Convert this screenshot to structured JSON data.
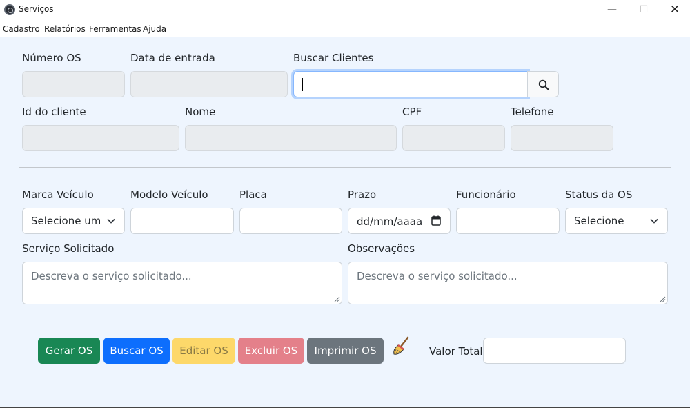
{
  "window": {
    "title": "Serviços"
  },
  "menu": [
    "Cadastro",
    "Relatórios",
    "Ferramentas",
    "Ajuda"
  ],
  "labels": {
    "numero_os": "Número OS",
    "data_entrada": "Data de entrada",
    "buscar_clientes": "Buscar Clientes",
    "id_cliente": "Id do cliente",
    "nome": "Nome",
    "cpf": "CPF",
    "telefone": "Telefone",
    "marca_veiculo": "Marca Veículo",
    "modelo_veiculo": "Modelo Veículo",
    "placa": "Placa",
    "prazo": "Prazo",
    "funcionario": "Funcionário",
    "status_os": "Status da OS",
    "servico_solicitado": "Serviço Solicitado",
    "observacoes": "Observações",
    "valor_total": "Valor Total"
  },
  "fields": {
    "marca_select": "Selecione uma",
    "status_select": "Selecione",
    "prazo_value": "dd/mm/aaaa",
    "servico_placeholder": "Descreva o serviço solicitado...",
    "observacoes_placeholder": "Descreva o serviço solicitado..."
  },
  "buttons": {
    "gerar": "Gerar OS",
    "buscar": "Buscar OS",
    "editar": "Editar OS",
    "excluir": "Excluir OS",
    "imprimir": "Imprimir OS"
  },
  "icons": {
    "search": "search-icon",
    "broom": "broom-icon",
    "calendar": "calendar-icon",
    "chevron": "chevron-down-icon"
  },
  "colors": {
    "background": "#eef5fe",
    "green": "#198754",
    "blue": "#0d6efd",
    "yellow": "#fdd86a",
    "red": "#e4808a",
    "gray": "#6c757d"
  }
}
